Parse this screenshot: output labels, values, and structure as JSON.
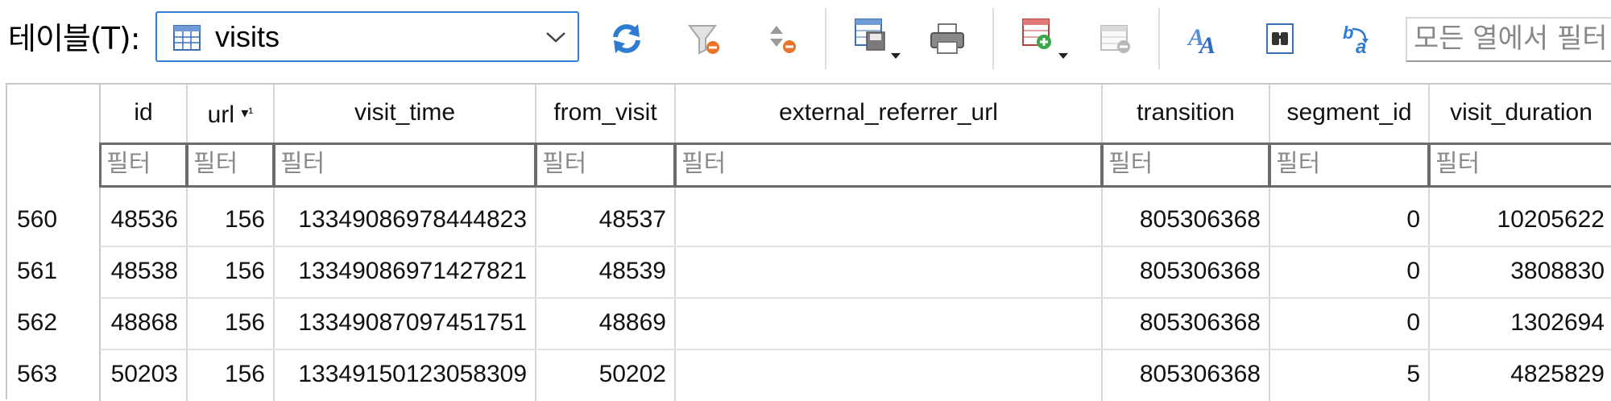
{
  "toolbar": {
    "table_label": "테이블(T):",
    "table_select_value": "visits",
    "filter_all_placeholder": "모든 열에서 필터",
    "icons": [
      "refresh-icon",
      "clear-filters-icon",
      "clear-sorting-icon",
      "save-table-icon",
      "print-icon",
      "insert-record-icon",
      "delete-record-icon",
      "conditional-format-icon",
      "find-icon",
      "find-replace-icon"
    ]
  },
  "table": {
    "columns": [
      {
        "label": "id",
        "filter_placeholder": "필터"
      },
      {
        "label": "url",
        "sort_indicator": "▾¹",
        "filter_placeholder": "필터"
      },
      {
        "label": "visit_time",
        "filter_placeholder": "필터"
      },
      {
        "label": "from_visit",
        "filter_placeholder": "필터"
      },
      {
        "label": "external_referrer_url",
        "filter_placeholder": "필터"
      },
      {
        "label": "transition",
        "filter_placeholder": "필터"
      },
      {
        "label": "segment_id",
        "filter_placeholder": "필터"
      },
      {
        "label": "visit_duration",
        "filter_placeholder": "필터"
      }
    ],
    "rows": [
      {
        "row_num": "560",
        "cells": [
          "48536",
          "156",
          "13349086978444823",
          "48537",
          "",
          "805306368",
          "0",
          "10205622"
        ]
      },
      {
        "row_num": "561",
        "cells": [
          "48538",
          "156",
          "13349086971427821",
          "48539",
          "",
          "805306368",
          "0",
          "3808830"
        ]
      },
      {
        "row_num": "562",
        "cells": [
          "48868",
          "156",
          "13349087097451751",
          "48869",
          "",
          "805306368",
          "0",
          "1302694"
        ]
      },
      {
        "row_num": "563",
        "cells": [
          "50203",
          "156",
          "13349150123058309",
          "50202",
          "",
          "805306368",
          "5",
          "4825829"
        ]
      }
    ]
  },
  "colors": {
    "select_border": "#2f7fd8",
    "grid_line": "#d6d6d6",
    "filter_border": "#6b6b6b"
  }
}
